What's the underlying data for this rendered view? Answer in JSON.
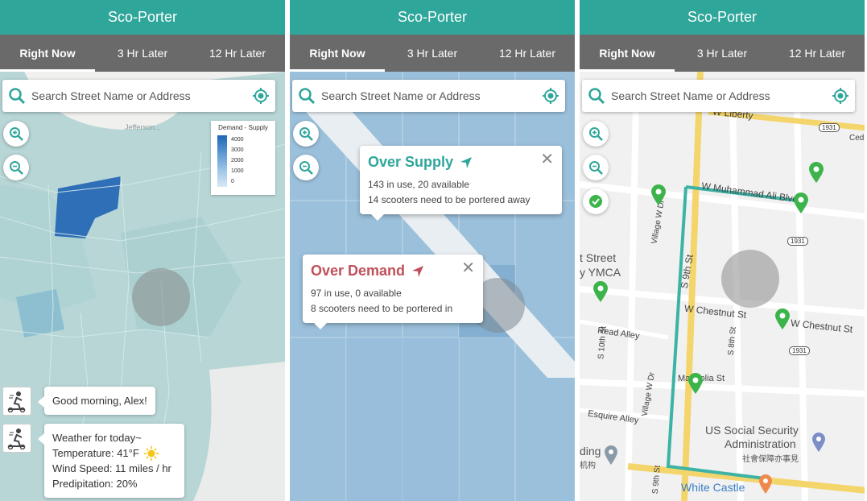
{
  "app": {
    "title": "Sco-Porter"
  },
  "tabs": [
    "Right Now",
    "3 Hr Later",
    "12 Hr Later"
  ],
  "search": {
    "placeholder": "Search Street Name or Address"
  },
  "colors": {
    "brand": "#2ea69a",
    "tabbar": "#6a6a6a",
    "over_supply": "#2ea69a",
    "over_demand": "#c0505a",
    "pin": "#3cb44b",
    "route": "#3cb3a5"
  },
  "icons": [
    "search-icon",
    "locate-icon",
    "zoom-in-icon",
    "zoom-out-icon",
    "check-icon",
    "scooter-avatar-icon",
    "sun-icon",
    "navigation-arrow-icon",
    "close-icon",
    "map-pin-icon"
  ],
  "screen1": {
    "map_label": "Jefferson...",
    "legend": {
      "title": "Demand - Supply",
      "ticks": [
        "4000",
        "3000",
        "2000",
        "1000",
        "0"
      ]
    },
    "greeting": "Good morning, Alex!",
    "weather": {
      "heading": "Weather for today~",
      "temperature": "Temperature: 41°F",
      "wind": "Wind Speed: 11 miles / hr",
      "precipitation": "Predipitation: 20%"
    }
  },
  "screen2": {
    "over_supply": {
      "title": "Over Supply",
      "line1": "143 in use, 20 available",
      "line2": "14 scooters need to be portered away"
    },
    "over_demand": {
      "title": "Over Demand",
      "line1": "97 in use, 0 available",
      "line2": "8 scooters need to be portered in"
    },
    "close": "✕"
  },
  "screen3": {
    "streets": {
      "w_liberty": "W Liberty",
      "w_muhammad_ali": "W Muhammad Ali Blvd",
      "w_chestnut_1": "W Chestnut St",
      "w_chestnut_2": "W Chestnut St",
      "s_9th": "S 9th St",
      "s_8th": "S 8th St",
      "s_10th": "S 10th St",
      "s_9th_bottom": "S 9th St",
      "village_w_dr_1": "Village W Dr",
      "village_w_dr_2": "Village W Dr",
      "read_alley": "Read Alley",
      "esquire_alley": "Esquire Alley",
      "magnolia": "Magnolia St",
      "cedar": "Ced"
    },
    "shields": [
      "1931",
      "1931",
      "1931"
    ],
    "poi": {
      "ymca_1": "t Street",
      "ymca_2": "y YMCA",
      "ssa_1": "US Social Security",
      "ssa_2": "Administration",
      "ssa_3": "社會保障亦事見",
      "building": "ding",
      "building2": "机构",
      "white_castle": "White Castle"
    }
  }
}
